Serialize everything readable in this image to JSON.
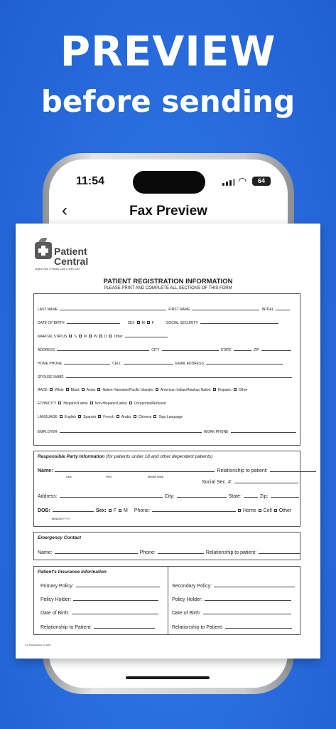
{
  "hero": {
    "line1": "PREVIEW",
    "line2": "before sending"
  },
  "status": {
    "time": "11:54",
    "battery": "64"
  },
  "nav": {
    "title": "Fax Preview",
    "back_icon": "chevron-left-icon"
  },
  "doc": {
    "logo_name": "Patient Central",
    "logo_tagline": "Urgent Care • Primary Care • Heart Care",
    "title": "PATIENT REGISTRATION INFORMATION",
    "subtitle": "PLEASE PRINT AND COMPLETE ALL SECTIONS OF THIS FORM",
    "p": {
      "last_name": "LAST NAME",
      "first_name": "FIRST NAME",
      "initial": "INITIAL",
      "dob": "DATE OF BIRTH",
      "sex": "SEX",
      "m": "M",
      "f": "F",
      "ssn": "SOCIAL SECURITY",
      "marital": "MARITAL STATUS",
      "s": "S",
      "mm": "M",
      "w": "W",
      "d": "D",
      "other": "Other",
      "address": "ADDRESS",
      "city": "CITY",
      "state": "STATE",
      "zip": "ZIP",
      "home_phone": "HOME PHONE",
      "cell": "CELL",
      "email": "EMAIL ADDRESS",
      "spouse": "SPOUSE NAME",
      "race": "RACE",
      "race_opts": [
        "White",
        "Black",
        "Asian",
        "Native Hawaiian/Pacific Islander",
        "American Indian/Alaskan Native",
        "Hispanic",
        "Other"
      ],
      "ethnicity": "ETHNICITY",
      "eth_opts": [
        "Hispanic/Latino",
        "Non-Hispanic/Latino",
        "Unreported/Refused"
      ],
      "language": "LANGUAGE",
      "lang_opts": [
        "English",
        "Spanish",
        "French",
        "Arabic",
        "Chinese",
        "Sign Language"
      ],
      "employer": "EMPLOYER",
      "work_phone": "WORK PHONE"
    },
    "rp": {
      "heading": "Responsible Party Information",
      "note": "(for patients under 18 and other dependent patients)",
      "name": "Name:",
      "last": "Last",
      "first": "First",
      "middle": "Middle Initial",
      "relationship": "Relationship to patient:",
      "social": "Social Sec. #:",
      "address": "Address:",
      "city": "City:",
      "state": "State:",
      "zip": "Zip:",
      "dob": "DOB:",
      "dob_fmt": "MM/DD/YYYY",
      "sex": "Sex:",
      "f": "F",
      "m": "M",
      "phone": "Phone:",
      "home": "Home",
      "cell": "Cell",
      "other": "Other"
    },
    "ec": {
      "heading": "Emergency Contact",
      "name": "Name:",
      "phone": "Phone:",
      "relationship": "Relationship to patient:"
    },
    "ins": {
      "heading": "Patient's Insurance Information",
      "primary": "Primary Policy:",
      "holder": "Policy Holder:",
      "dob": "Date of Birth:",
      "rel": "Relationship to Patient:",
      "secondary": "Secondary Policy:",
      "holder2": "Policy Holder:",
      "dob2": "Date of Birth:",
      "rel2": "Relationship to Patient:"
    },
    "footer": "1 of 6 Registration V1 2015"
  }
}
